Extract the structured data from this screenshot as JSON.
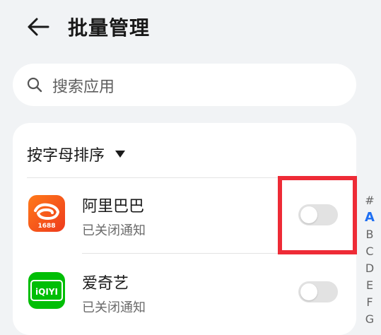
{
  "header": {
    "title": "批量管理",
    "back_icon": "back-arrow-icon"
  },
  "search": {
    "placeholder": "搜索应用",
    "icon": "search-icon"
  },
  "sort": {
    "label": "按字母排序",
    "caret_icon": "triangle-down-icon"
  },
  "apps": [
    {
      "name": "阿里巴巴",
      "status": "已关闭通知",
      "icon_text": "1688",
      "notifications_on": false
    },
    {
      "name": "爱奇艺",
      "status": "已关闭通知",
      "icon_text": "iQIYI",
      "notifications_on": false
    }
  ],
  "index_bar": {
    "letters": [
      "#",
      "A",
      "B",
      "C",
      "D",
      "E",
      "F",
      "G"
    ],
    "active": "A"
  },
  "colors": {
    "background": "#f1f3f5",
    "card": "#ffffff",
    "accent_blue": "#1f6ff2",
    "highlight_red": "#ee2b36",
    "alibaba_orange": "#f2581f",
    "iqiyi_green": "#00be06",
    "toggle_off": "#e2e2e2"
  }
}
